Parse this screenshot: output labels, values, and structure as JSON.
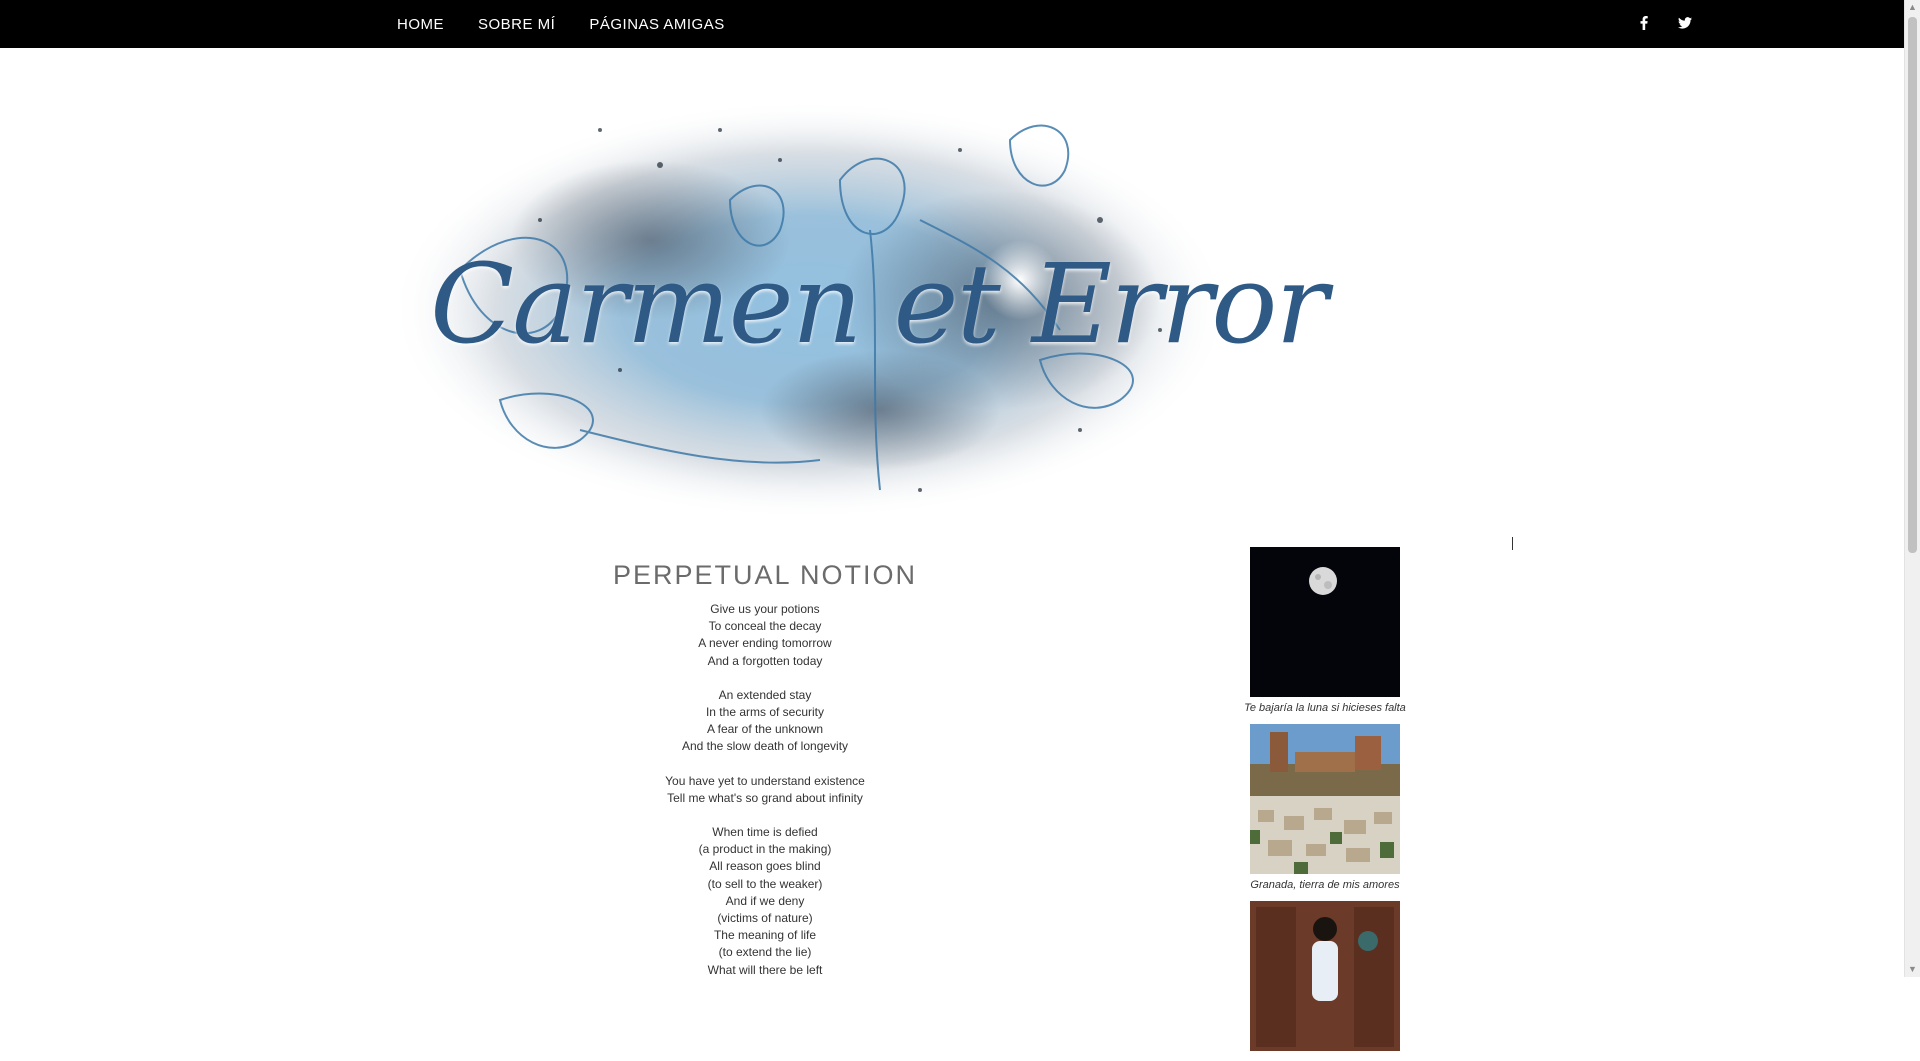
{
  "nav": {
    "items": [
      {
        "label": "HOME"
      },
      {
        "label": "SOBRE MÍ"
      },
      {
        "label": "PÁGINAS AMIGAS"
      }
    ],
    "social": [
      {
        "icon": "facebook-icon",
        "glyph": "f"
      },
      {
        "icon": "twitter-icon",
        "glyph": "🐦"
      }
    ]
  },
  "header": {
    "title": "Carmen et Error",
    "colors": {
      "ink": "#2f5a86",
      "wash": "#6fa6cc"
    }
  },
  "post": {
    "title": "PERPETUAL NOTION",
    "stanzas": [
      [
        "Give us your potions",
        "To conceal the decay",
        "A never ending tomorrow",
        "And a forgotten today"
      ],
      [
        "An extended stay",
        "In the arms of security",
        "A fear of the unknown",
        "And the slow death of longevity"
      ],
      [
        "You have yet to understand existence",
        "Tell me what's so grand about infinity"
      ],
      [
        "When time is defied",
        "(a product in the making)",
        "All reason goes blind",
        "(to sell to the weaker)",
        "And if we deny",
        "(victims of nature)",
        "The meaning of life",
        "(to extend the lie)",
        "What will there be left"
      ]
    ]
  },
  "sidebar": {
    "widgets": [
      {
        "caption": "Te bajaría la luna si hicieses falta"
      },
      {
        "caption": "Granada, tierra de mis amores"
      },
      {
        "caption": ""
      }
    ]
  }
}
